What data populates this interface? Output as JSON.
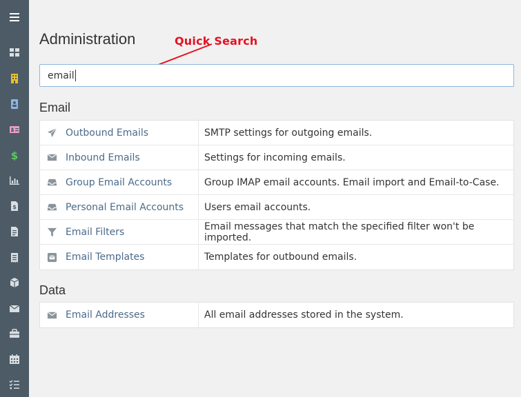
{
  "sidebar": {
    "items": [
      {
        "icon": "hamburger-menu-icon",
        "color": "#ffffff"
      },
      {
        "icon": "dashboard-icon",
        "color": "#d9dee2"
      },
      {
        "icon": "building-icon",
        "color": "#e8c228"
      },
      {
        "icon": "contact-book-icon",
        "color": "#8db5e2"
      },
      {
        "icon": "id-card-icon",
        "color": "#e9a0c8"
      },
      {
        "icon": "dollar-icon",
        "color": "#5bc95e"
      },
      {
        "icon": "bar-chart-icon",
        "color": "#d9dee2"
      },
      {
        "icon": "invoice-icon",
        "color": "#d9dee2"
      },
      {
        "icon": "document-icon",
        "color": "#d9dee2"
      },
      {
        "icon": "receipt-icon",
        "color": "#d9dee2"
      },
      {
        "icon": "cube-icon",
        "color": "#d9dee2"
      },
      {
        "icon": "envelope-icon",
        "color": "#d9dee2"
      },
      {
        "icon": "briefcase-icon",
        "color": "#d9dee2"
      },
      {
        "icon": "calendar-icon",
        "color": "#d9dee2"
      },
      {
        "icon": "task-list-icon",
        "color": "#d9dee2"
      }
    ]
  },
  "page": {
    "title": "Administration"
  },
  "annotation": {
    "label": "Quick Search",
    "color": "#e8101f"
  },
  "search": {
    "value": "email"
  },
  "sections": [
    {
      "title": "Email",
      "rows": [
        {
          "icon": "paper-plane-icon",
          "name": "Outbound Emails",
          "description": "SMTP settings for outgoing emails."
        },
        {
          "icon": "envelope-icon",
          "name": "Inbound Emails",
          "description": "Settings for incoming emails."
        },
        {
          "icon": "inbox-icon",
          "name": "Group Email Accounts",
          "description": "Group IMAP email accounts. Email import and Email-to-Case."
        },
        {
          "icon": "inbox-icon",
          "name": "Personal Email Accounts",
          "description": "Users email accounts."
        },
        {
          "icon": "filter-icon",
          "name": "Email Filters",
          "description": "Email messages that match the specified filter won't be imported."
        },
        {
          "icon": "envelope-square-icon",
          "name": "Email Templates",
          "description": "Templates for outbound emails."
        }
      ]
    },
    {
      "title": "Data",
      "rows": [
        {
          "icon": "envelope-icon",
          "name": "Email Addresses",
          "description": "All email addresses stored in the system."
        }
      ]
    }
  ],
  "colors": {
    "sidebar_bg": "#4c5b65",
    "link": "#4a6a8a",
    "row_icon": "#8a949b"
  }
}
